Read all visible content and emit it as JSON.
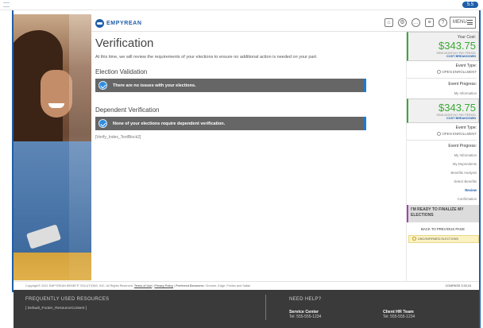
{
  "topbar": {
    "badge": "5.5"
  },
  "header": {
    "logo_text": "EMPYREAN",
    "icons": [
      "home-icon",
      "gear-icon",
      "chat-icon",
      "document-icon",
      "help-icon"
    ],
    "menu_label": "MENU"
  },
  "main": {
    "title": "Verification",
    "intro": "At this time, we will review the requirements of your elections to ensure no additional action is needed on your part.",
    "election_validation": {
      "title": "Election Validation",
      "message": "There are no issues with your elections."
    },
    "dependent_verification": {
      "title": "Dependent Verification",
      "message": "None of your elections require dependent verification."
    },
    "placeholder_text": "[Verify_Index_TextBlock2]"
  },
  "sidebar": {
    "cost_blocks": [
      {
        "label": "Your Cost:",
        "amount": "$343.75",
        "period": "SEMI-MONTHLY PAY PERIOD",
        "link": "COST BREAKDOWN"
      },
      {
        "label": "",
        "amount": "$343.75",
        "period": "SEMI-MONTHLY PAY PERIOD",
        "link": "COST BREAKDOWN"
      }
    ],
    "event_type_label": "Event Type:",
    "event_type_value": "OPEN ENROLLMENT",
    "event_progress_label": "Event Progress:",
    "progress_first": "My Information",
    "progress_steps": [
      "My Information",
      "My Dependents",
      "Benefits Analysis",
      "Select Benefits",
      "Review",
      "Confirmation"
    ],
    "active_step": "Review",
    "finalize_label": "I'M READY TO FINALIZE MY ELECTIONS",
    "back_label": "BACK TO PREVIOUS PAGE",
    "unconfirmed_label": "UNCONFIRMED ELECTIONS"
  },
  "copyright": {
    "text": "Copyright© 2021 EMPYREAN BENEFIT SOLUTIONS, INC. All Rights Reserved.",
    "terms": "Terms of Use",
    "privacy": "Privacy Policy",
    "browsers_label": "Preferred Browsers:",
    "browsers": "Chrome, Edge, Firefox and Safari",
    "build": "COMPASS 3.93.15"
  },
  "footer": {
    "resources_title": "FREQUENTLY USED RESOURCES",
    "resources_link": "[ Default_Footer_ResourceContent ]",
    "help_title": "NEED HELP?",
    "contacts": [
      {
        "name": "Service Center",
        "phone": "Tel: 555-555-1234"
      },
      {
        "name": "Client HR Team",
        "phone": "Tel: 555-555-1234"
      }
    ]
  }
}
